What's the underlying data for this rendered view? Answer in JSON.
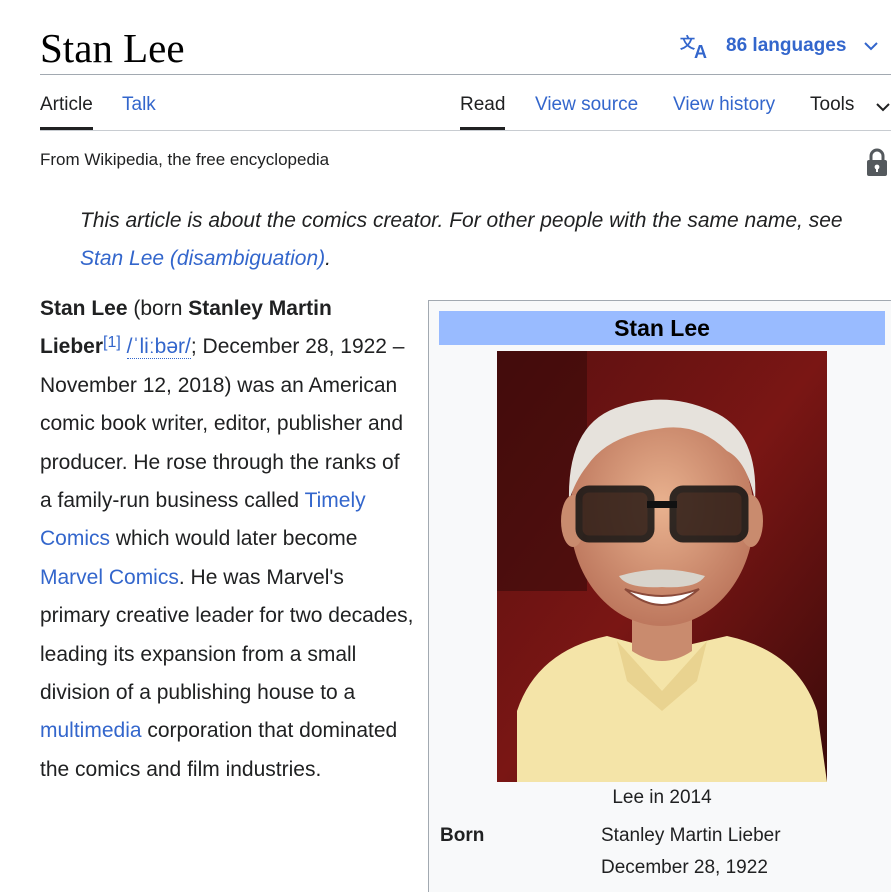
{
  "page": {
    "title": "Stan Lee",
    "languages_label": "86 languages",
    "tagline": "From Wikipedia, the free encyclopedia"
  },
  "tabs": {
    "article": "Article",
    "talk": "Talk",
    "read": "Read",
    "view_source": "View source",
    "view_history": "View history",
    "tools": "Tools"
  },
  "hatnote": {
    "prefix": "This article is about the comics creator. For other people with the same name, see ",
    "link": "Stan Lee (disambiguation)",
    "suffix": "."
  },
  "lead": {
    "name": "Stan Lee",
    "t1": " (born ",
    "birth_name": "Stanley Martin Lieber",
    "ref": "[1]",
    "ipa": "/ˈliːbər/",
    "t2": "; December 28, 1922 – November 12, 2018) was an American comic book writer, editor, publisher and producer. He rose through the ranks of a family-run business called ",
    "link1": "Timely Comics",
    "t3": " which would later become ",
    "link2": "Marvel Comics",
    "t4": ". He was Marvel's primary creative leader for two decades, leading its expansion from a small division of a publishing house to a ",
    "link3": "multimedia",
    "t5": " corporation that dominated the comics and film industries."
  },
  "infobox": {
    "title": "Stan Lee",
    "caption": "Lee in 2014",
    "born_label": "Born",
    "born_name": "Stanley Martin Lieber",
    "born_date": "December 28, 1922"
  },
  "icons": {
    "translate": "translate-icon",
    "chevron": "chevron-down-icon",
    "lock": "lock-icon"
  },
  "colors": {
    "link": "#3366cc",
    "infobox_header": "#99bbff",
    "infobox_bg": "#f8f9fa"
  }
}
